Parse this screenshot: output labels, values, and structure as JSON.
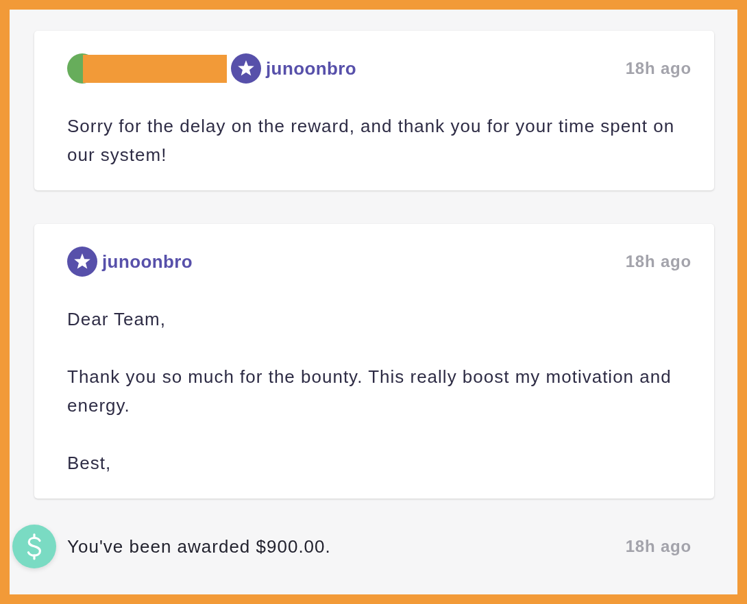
{
  "comments": [
    {
      "participants": [
        {
          "kind": "redacted"
        },
        {
          "kind": "hacker",
          "name": "junoonbro"
        }
      ],
      "time": "18h ago",
      "body": [
        "Sorry for the delay on the reward, and thank you for your time spent on our system!"
      ]
    },
    {
      "participants": [
        {
          "kind": "hacker",
          "name": "junoonbro"
        }
      ],
      "time": "18h ago",
      "body": [
        "Dear Team,",
        "Thank you so much for the bounty. This really boost my motivation and energy.",
        "Best,"
      ]
    }
  ],
  "activity": {
    "kind": "bounty",
    "text": "You've been awarded $900.00.",
    "time": "18h ago"
  }
}
